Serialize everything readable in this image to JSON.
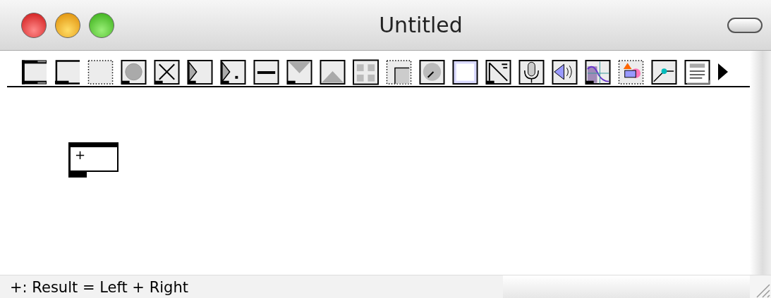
{
  "window": {
    "title": "Untitled"
  },
  "patcher": {
    "objects": [
      {
        "kind": "object",
        "text": "+"
      }
    ]
  },
  "status_bar": {
    "text": "+: Result = Left + Right"
  }
}
